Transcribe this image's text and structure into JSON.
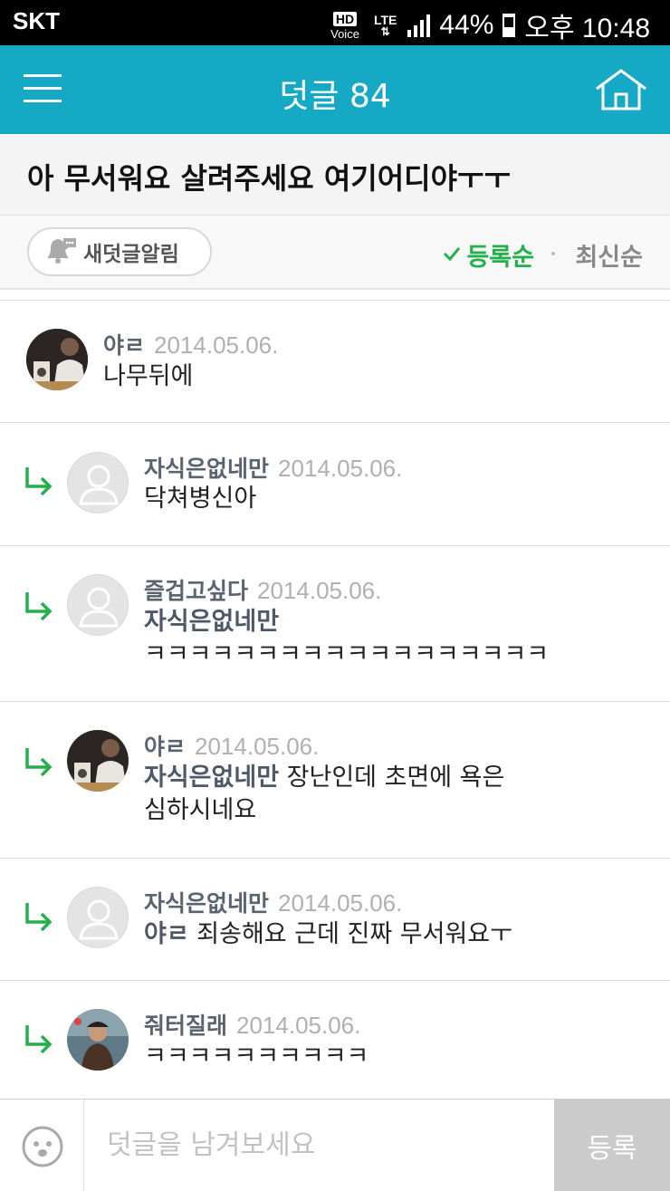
{
  "statusbar": {
    "carrier": "SKT",
    "hd": "HD",
    "voice": "Voice",
    "lte": "LTE",
    "battery_pct": "44%",
    "battery_level": 0.44,
    "time": "오후 10:48"
  },
  "header": {
    "title": "덧글 84",
    "accent": "#15a9c5"
  },
  "post": {
    "title": "아 무서워요 살려주세요 여기어디야ㅜㅜ"
  },
  "sortbar": {
    "notify_label": "새덧글알림",
    "sort_registered": "등록순",
    "sort_latest": "최신순",
    "active_color": "#22b04b"
  },
  "comments": [
    {
      "author": "야ㄹ",
      "date": "2014.05.06.",
      "mention": "",
      "text": "나무뒤에",
      "text2": ""
    },
    {
      "author": "자식은없네만",
      "date": "2014.05.06.",
      "mention": "",
      "text": "닥쳐병신아",
      "text2": ""
    },
    {
      "author": "즐겁고싶다",
      "date": "2014.05.06.",
      "mention": "자식은없네만",
      "text": "",
      "text2": "ㅋㅋㅋㅋㅋㅋㅋㅋㅋㅋㅋㅋㅋㅋㅋㅋㅋㅋ"
    },
    {
      "author": "야ㄹ",
      "date": "2014.05.06.",
      "mention": "자식은없네만",
      "text": "장난인데 초면에 욕은",
      "text2": "심하시네요"
    },
    {
      "author": "자식은없네만",
      "date": "2014.05.06.",
      "mention": "야ㄹ",
      "text": "죄송해요 근데 진짜 무서워요ㅜ",
      "text2": ""
    },
    {
      "author": "줘터질래",
      "date": "2014.05.06.",
      "mention": "",
      "text": "ㅋㅋㅋㅋㅋㅋㅋㅋㅋㅋ",
      "text2": ""
    }
  ],
  "composer": {
    "placeholder": "덧글을 남겨보세요",
    "submit_label": "등록"
  },
  "icons": [
    "menu-icon",
    "home-icon",
    "bell-icon",
    "check-icon",
    "reply-arrow-icon",
    "avatar-icon",
    "emoji-icon"
  ]
}
